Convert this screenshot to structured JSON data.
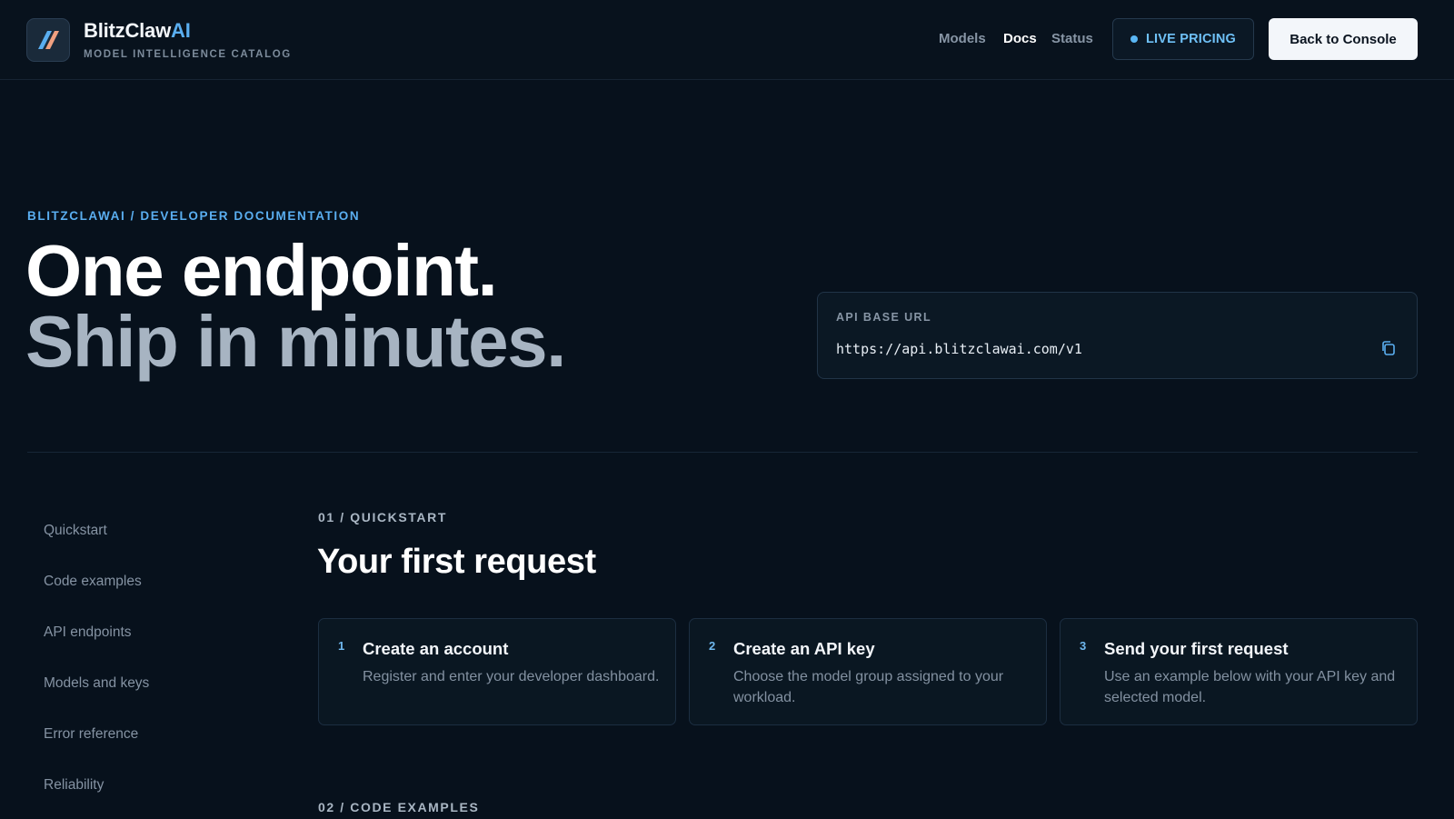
{
  "header": {
    "brand_main": "BlitzClaw",
    "brand_accent": "AI",
    "subtitle": "MODEL INTELLIGENCE CATALOG",
    "nav": [
      {
        "label": "Models",
        "active": false
      },
      {
        "label": "Docs",
        "active": true
      },
      {
        "label": "Status",
        "active": false
      }
    ],
    "live_pricing": "LIVE PRICING",
    "back_button": "Back to Console"
  },
  "hero": {
    "breadcrumb": "BLITZCLAWAI / DEVELOPER DOCUMENTATION",
    "line1": "One endpoint.",
    "line2": "Ship in minutes."
  },
  "api": {
    "label": "API BASE URL",
    "url": "https://api.blitzclawai.com/v1"
  },
  "sidebar": {
    "items": [
      {
        "label": "Quickstart"
      },
      {
        "label": "Code examples"
      },
      {
        "label": "API endpoints"
      },
      {
        "label": "Models and keys"
      },
      {
        "label": "Error reference"
      },
      {
        "label": "Reliability"
      }
    ]
  },
  "quickstart": {
    "section_label": "01 / QUICKSTART",
    "title": "Your first request",
    "steps": [
      {
        "num": "1",
        "title": "Create an account",
        "desc": "Register and enter your developer dashboard."
      },
      {
        "num": "2",
        "title": "Create an API key",
        "desc": "Choose the model group assigned to your workload."
      },
      {
        "num": "3",
        "title": "Send your first request",
        "desc": "Use an example below with your API key and selected model."
      }
    ]
  },
  "next_section": {
    "label": "02 / CODE EXAMPLES"
  },
  "colors": {
    "background": "#07111c",
    "accent": "#5aaef0",
    "button_bg": "#f3f6fa"
  },
  "icons": [
    "logo-icon",
    "live-dot-icon",
    "copy-icon"
  ]
}
